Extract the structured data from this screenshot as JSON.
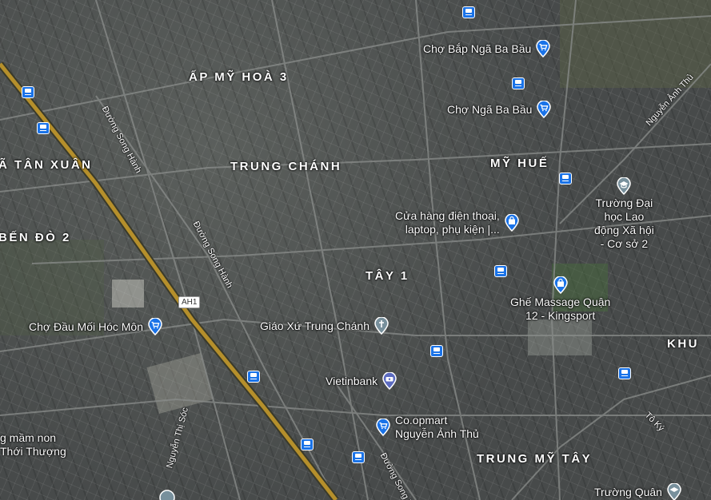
{
  "map": {
    "areas": {
      "ap_my_hoa_3": "ẤP MỸ HOÀ 3",
      "tan_xuan": "Ã TÂN XUÂN",
      "trung_chanh": "TRUNG CHÁNH",
      "my_hue": "MỸ HUẾ",
      "ben_do_2": "BẾN ĐÒ 2",
      "tay_1": "TÂY 1",
      "khu": "KHU",
      "trung_my_tay": "TRUNG MỸ TÂY"
    },
    "places": {
      "cho_bap": "Chợ Bắp Ngã Ba Bầu",
      "cho_nga_ba_bau": "Chợ Ngã Ba Bầu",
      "cua_hang_line1": "Cửa hàng điện thoại,",
      "cua_hang_line2": "laptop, phụ kiện |...",
      "truong_dh_line1": "Trường Đại",
      "truong_dh_line2": "học Lao",
      "truong_dh_line3": "động Xã hội",
      "truong_dh_line4": "- Cơ sở 2",
      "ghe_massage_line1": "Ghế Massage Quận",
      "ghe_massage_line2": "12 - Kingsport",
      "cho_dau_moi": "Chợ Đầu Mối Hóc Môn",
      "giao_xu": "Giáo Xứ Trung Chánh",
      "vietinbank": "Vietinbank",
      "coopmart_line1": "Co.opmart",
      "coopmart_line2": "Nguyễn Ảnh Thủ",
      "mam_non_line1": "g mầm non",
      "mam_non_line2": "Thới Thượng",
      "truong_quan": "Trường Quân"
    },
    "roads": {
      "song_hanh_1": "Đường Song Hành",
      "song_hanh_2": "Đường Song Hành",
      "song_hanh_3": "Đường Song Hà",
      "nguyen_anh_thu": "Nguyễn Ảnh Thủ",
      "nguyen_thi_soc": "Nguyễn Thị Sóc",
      "to_ky": "Tô Ký",
      "ah1": "AH1"
    },
    "colors": {
      "highway": "#b58f2b",
      "pin_shopping": "#1a73e8",
      "pin_school": "#78909c",
      "pin_bank": "#5c6bc0",
      "bus": "#1a73e8"
    }
  }
}
